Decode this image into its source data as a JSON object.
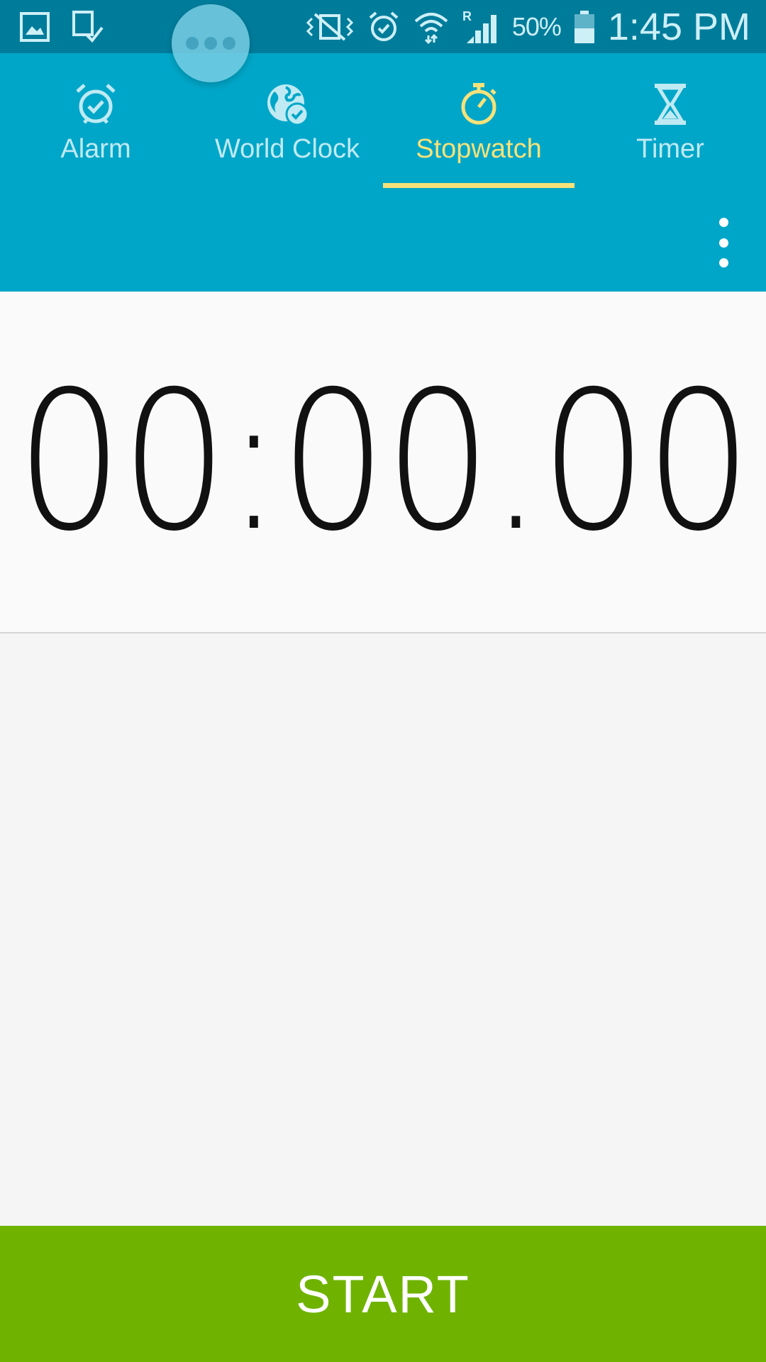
{
  "status_bar": {
    "left_icons": [
      "gallery-icon",
      "screenshot-check-icon"
    ],
    "right_icons": [
      "vibrate-mute-icon",
      "alarm-icon",
      "wifi-icon",
      "roaming-signal-icon",
      "battery-icon"
    ],
    "battery_percent": "50%",
    "time": "1:45 PM"
  },
  "tabs": [
    {
      "label": "Alarm",
      "icon": "alarm-clock-icon",
      "active": false
    },
    {
      "label": "World Clock",
      "icon": "globe-check-icon",
      "active": false
    },
    {
      "label": "Stopwatch",
      "icon": "stopwatch-icon",
      "active": true
    },
    {
      "label": "Timer",
      "icon": "hourglass-icon",
      "active": false
    }
  ],
  "stopwatch": {
    "time": "00:00.00"
  },
  "actions": {
    "start_label": "START"
  },
  "colors": {
    "status_bar": "#007c9b",
    "header": "#00a6c8",
    "active_tab": "#f6e27a",
    "inactive_tab": "#bfeaf3",
    "start_button": "#6fb300"
  }
}
